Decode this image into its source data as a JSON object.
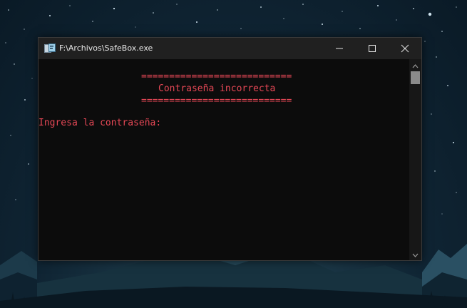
{
  "window": {
    "title": "F:\\Archivos\\SafeBox.exe",
    "icon": "console-app-icon",
    "controls": {
      "minimize": "minimize-icon",
      "maximize": "maximize-icon",
      "close": "close-icon"
    }
  },
  "console": {
    "lines": [
      "===========================",
      "Contraseña incorrecta",
      "===========================",
      "Ingresa la contraseña:"
    ],
    "text_color": "#e74856",
    "background": "#0c0c0c"
  },
  "colors": {
    "titlebar": "#202020",
    "title_text": "#e6e6e6",
    "scroll_thumb": "#8a8a8a"
  }
}
